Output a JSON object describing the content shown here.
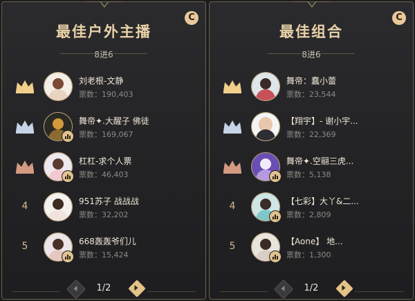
{
  "panels": [
    {
      "title": "最佳户外主播",
      "subtitle": "8进6",
      "badge": "C",
      "page": "1/2",
      "entries": [
        {
          "rank": "crown",
          "crown_color": "#f0cf8a",
          "name": "刘老根-文静",
          "votes": "票数：190,403",
          "live": false
        },
        {
          "rank": "crown",
          "crown_color": "#c7d3e6",
          "name": "舞帝✦.大醒子 佛徒",
          "votes": "票数：169,067",
          "live": true
        },
        {
          "rank": "crown",
          "crown_color": "#d49a82",
          "name": "杠杠-求个人票",
          "votes": "票数：46,403",
          "live": true
        },
        {
          "rank": "4",
          "name": "951苏子 战战战",
          "votes": "票数：32,202",
          "live": false
        },
        {
          "rank": "5",
          "name": "668轰轰爷们儿",
          "votes": "票数：15,424",
          "live": true
        }
      ]
    },
    {
      "title": "最佳组合",
      "subtitle": "8进6",
      "badge": "C",
      "page": "1/2",
      "entries": [
        {
          "rank": "crown",
          "crown_color": "#f0cf8a",
          "name": "舞帝：蠢小蕾",
          "votes": "票数：23,544",
          "live": false
        },
        {
          "rank": "crown",
          "crown_color": "#c7d3e6",
          "name": "【翔宇】- 谢小宇...",
          "votes": "票数：22,369",
          "live": false
        },
        {
          "rank": "crown",
          "crown_color": "#d49a82",
          "name": "舞帝✦.空翮三虎...",
          "votes": "票数：5,138",
          "live": true
        },
        {
          "rank": "4",
          "name": "【七彩】大丫&二...",
          "votes": "票数：2,809",
          "live": true
        },
        {
          "rank": "5",
          "name": "【Aone】 地...",
          "votes": "票数：1,300",
          "live": true
        }
      ]
    }
  ]
}
